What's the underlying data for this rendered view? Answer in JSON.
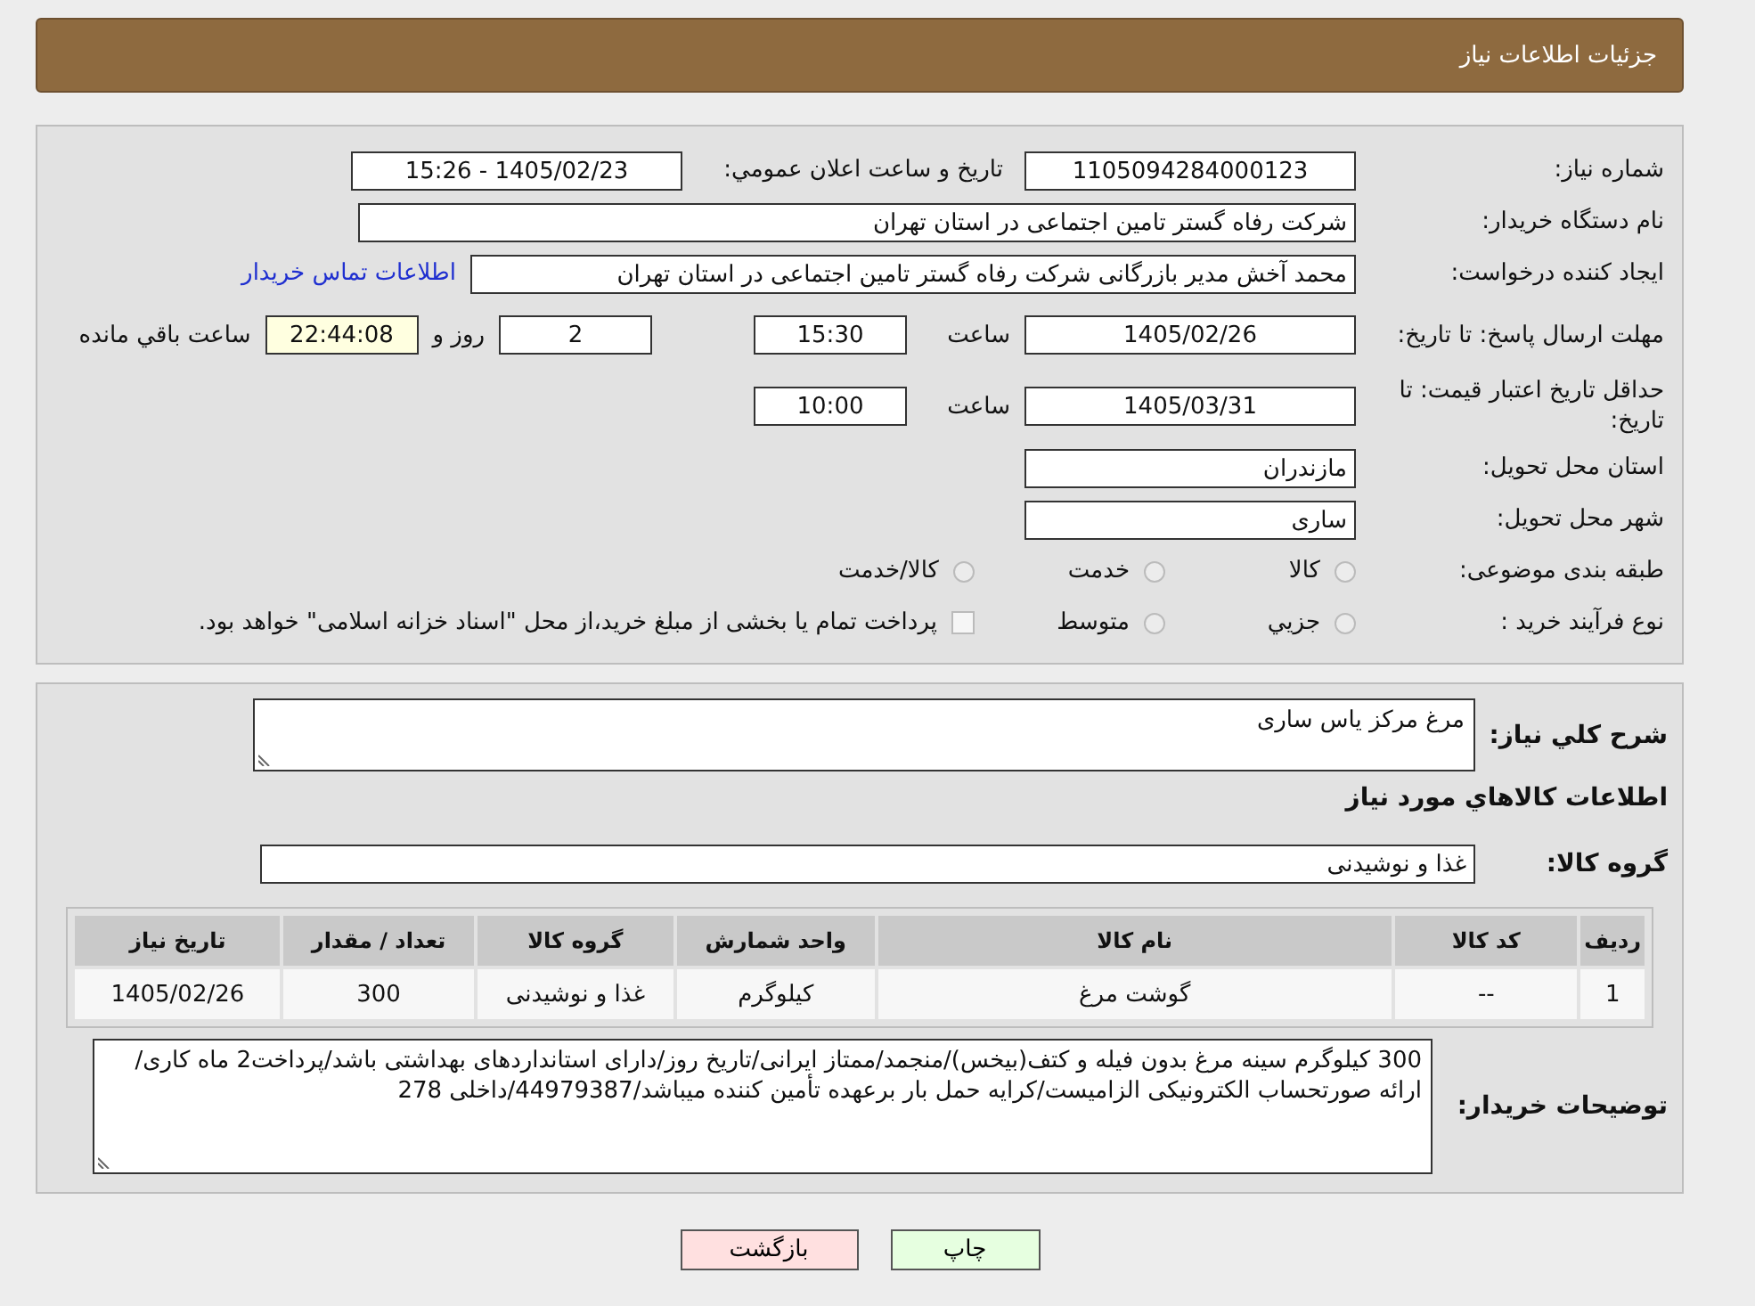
{
  "header": {
    "title": "جزئیات اطلاعات نیاز"
  },
  "need_number": {
    "label": "شماره نیاز:",
    "value": "1105094284000123"
  },
  "announce": {
    "label": "تاريخ و ساعت اعلان عمومي:",
    "value": "1405/02/23 - 15:26"
  },
  "buyer": {
    "label": "نام دستگاه خريدار:",
    "value": "شرکت رفاه گستر تامین اجتماعی در استان تهران"
  },
  "creator": {
    "label": "ايجاد كننده درخواست:",
    "value": "محمد آخش مدیر بازرگانی شرکت رفاه گستر تامین اجتماعی در استان تهران",
    "link": "اطلاعات تماس خريدار"
  },
  "deadline": {
    "label": "مهلت ارسال پاسخ: تا تاريخ:",
    "date": "1405/02/26",
    "time_label": "ساعت",
    "time": "15:30",
    "days": "2",
    "days_label": "روز و",
    "remaining": "22:44:08",
    "remaining_label": "ساعت باقي مانده"
  },
  "validity": {
    "label": "حداقل تاريخ اعتبار قيمت: تا تاريخ:",
    "date": "1405/03/31",
    "time_label": "ساعت",
    "time": "10:00"
  },
  "province": {
    "label": "استان محل تحویل:",
    "value": "مازندران"
  },
  "city": {
    "label": "شهر محل تحویل:",
    "value": "ساری"
  },
  "category": {
    "label": "طبقه بندی موضوعی:",
    "options": [
      {
        "kind": "radio",
        "label": "کالا",
        "selected": false
      },
      {
        "kind": "radio",
        "label": "خدمت",
        "selected": false
      },
      {
        "kind": "radio",
        "label": "کالا/خدمت",
        "selected": false
      }
    ]
  },
  "process": {
    "label": "نوع فرآیند خرید :",
    "options": [
      {
        "kind": "radio",
        "label": "جزيي",
        "selected": false
      },
      {
        "kind": "radio",
        "label": "متوسط",
        "selected": false
      },
      {
        "kind": "checkbox",
        "label": "پرداخت تمام یا بخشی از مبلغ خرید،از محل \"اسناد خزانه اسلامی\" خواهد بود.",
        "selected": false
      }
    ]
  },
  "description": {
    "label": "شرح کلي نياز:",
    "value": "مرغ مرکز یاس ساری"
  },
  "items_title": "اطلاعات کالاهاي مورد نياز",
  "group": {
    "label": "گروه کالا:",
    "value": "غذا و نوشیدنی"
  },
  "table": {
    "columns": [
      "ردیف",
      "کد کالا",
      "نام کالا",
      "واحد شمارش",
      "گروه کالا",
      "تعداد / مقدار",
      "تاریخ نیاز"
    ],
    "rows": [
      [
        "1",
        "--",
        "گوشت مرغ",
        "کیلوگرم",
        "غذا و نوشیدنی",
        "300",
        "1405/02/26"
      ]
    ]
  },
  "notes": {
    "label": "توضیحات خریدار:",
    "value": "300 کیلوگرم سینه مرغ بدون فیله و کتف(بیخس)/منجمد/ممتاز ایرانی/تاریخ روز/دارای استانداردهای بهداشتی باشد/پرداخت2 ماه کاری/ارائه صورتحساب الکترونیکی الزامیست/کرایه حمل بار برعهده تأمین کننده میباشد/44979387/داخلی 278"
  },
  "buttons": [
    {
      "kind": "print",
      "label": "چاپ"
    },
    {
      "kind": "back",
      "label": "بازگشت"
    }
  ]
}
